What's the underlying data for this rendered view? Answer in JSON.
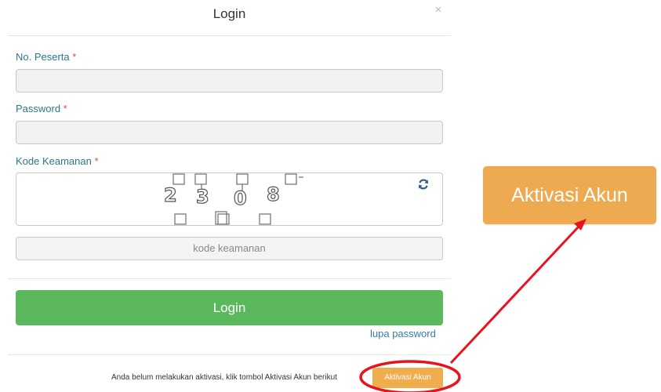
{
  "modal": {
    "title": "Login",
    "close_symbol": "×"
  },
  "form": {
    "participant": {
      "label": "No. Peserta",
      "required_mark": "*",
      "value": ""
    },
    "password": {
      "label": "Password",
      "required_mark": "*",
      "value": ""
    },
    "security": {
      "label": "Kode Keamanan",
      "required_mark": "*",
      "captcha_digits": [
        "2",
        "3",
        "0",
        "8"
      ],
      "refresh_icon": "refresh-icon",
      "input_placeholder": "kode keamanan"
    },
    "login_button": "Login",
    "forgot_link": "lupa password"
  },
  "activation": {
    "info_text": "Anda belum melakukan aktivasi, klik tombol Aktivasi Akun berikut",
    "button_label": "Aktivasi Akun",
    "zoomed_button_label": "Aktivasi Akun"
  },
  "colors": {
    "label": "#2a7a87",
    "required": "#e24a4a",
    "login_button": "#5cb85c",
    "activation_button": "#f0ad4e",
    "link": "#337ab7",
    "annotation": "#e8141c"
  }
}
